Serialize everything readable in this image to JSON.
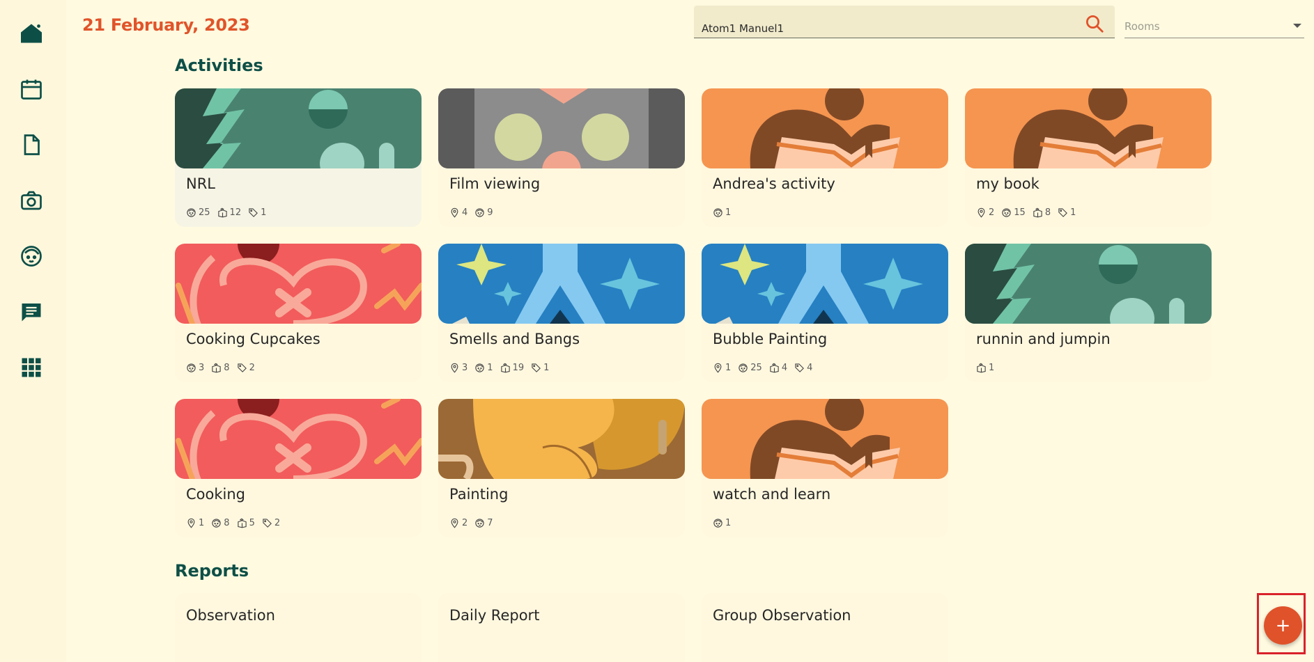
{
  "header": {
    "date": "21 February, 2023",
    "search_value": "Atom1 Manuel1",
    "rooms_placeholder": "Rooms"
  },
  "sidebar": {
    "items": [
      {
        "name": "home-icon"
      },
      {
        "name": "calendar-icon"
      },
      {
        "name": "document-icon"
      },
      {
        "name": "camera-icon"
      },
      {
        "name": "child-face-icon"
      },
      {
        "name": "message-icon"
      },
      {
        "name": "apps-grid-icon"
      }
    ]
  },
  "sections": {
    "activities_title": "Activities",
    "reports_title": "Reports"
  },
  "activities": [
    {
      "title": "NRL",
      "theme": "green",
      "stats": [
        {
          "icon": "child-face-icon",
          "value": "25"
        },
        {
          "icon": "activity-box-icon",
          "value": "12"
        },
        {
          "icon": "tag-icon",
          "value": "1"
        }
      ]
    },
    {
      "title": "Film viewing",
      "theme": "gray",
      "stats": [
        {
          "icon": "location-pin-icon",
          "value": "4"
        },
        {
          "icon": "child-face-icon",
          "value": "9"
        }
      ]
    },
    {
      "title": "Andrea's activity",
      "theme": "orange",
      "stats": [
        {
          "icon": "child-face-icon",
          "value": "1"
        }
      ]
    },
    {
      "title": "my book",
      "theme": "orange",
      "stats": [
        {
          "icon": "location-pin-icon",
          "value": "2"
        },
        {
          "icon": "child-face-icon",
          "value": "15"
        },
        {
          "icon": "activity-box-icon",
          "value": "8"
        },
        {
          "icon": "tag-icon",
          "value": "1"
        }
      ]
    },
    {
      "title": "Cooking Cupcakes",
      "theme": "red",
      "stats": [
        {
          "icon": "child-face-icon",
          "value": "3"
        },
        {
          "icon": "activity-box-icon",
          "value": "8"
        },
        {
          "icon": "tag-icon",
          "value": "2"
        }
      ]
    },
    {
      "title": "Smells and Bangs",
      "theme": "blue",
      "stats": [
        {
          "icon": "location-pin-icon",
          "value": "3"
        },
        {
          "icon": "child-face-icon",
          "value": "1"
        },
        {
          "icon": "activity-box-icon",
          "value": "19"
        },
        {
          "icon": "tag-icon",
          "value": "1"
        }
      ]
    },
    {
      "title": "Bubble Painting",
      "theme": "blue",
      "stats": [
        {
          "icon": "location-pin-icon",
          "value": "1"
        },
        {
          "icon": "child-face-icon",
          "value": "25"
        },
        {
          "icon": "activity-box-icon",
          "value": "4"
        },
        {
          "icon": "tag-icon",
          "value": "4"
        }
      ]
    },
    {
      "title": "runnin and jumpin",
      "theme": "green",
      "stats": [
        {
          "icon": "activity-box-icon",
          "value": "1"
        }
      ]
    },
    {
      "title": "Cooking",
      "theme": "red",
      "stats": [
        {
          "icon": "location-pin-icon",
          "value": "1"
        },
        {
          "icon": "child-face-icon",
          "value": "8"
        },
        {
          "icon": "activity-box-icon",
          "value": "5"
        },
        {
          "icon": "tag-icon",
          "value": "2"
        }
      ]
    },
    {
      "title": "Painting",
      "theme": "brown",
      "stats": [
        {
          "icon": "location-pin-icon",
          "value": "2"
        },
        {
          "icon": "child-face-icon",
          "value": "7"
        }
      ]
    },
    {
      "title": "watch and learn",
      "theme": "orange",
      "stats": [
        {
          "icon": "child-face-icon",
          "value": "1"
        }
      ]
    }
  ],
  "reports": [
    {
      "title": "Observation"
    },
    {
      "title": "Daily Report"
    },
    {
      "title": "Group Observation"
    }
  ],
  "fab": {
    "label": "+"
  },
  "colors": {
    "background": "#fffae0",
    "accent": "#e0522a",
    "brand_dark": "#0d4f47",
    "card": "#fff8df"
  }
}
